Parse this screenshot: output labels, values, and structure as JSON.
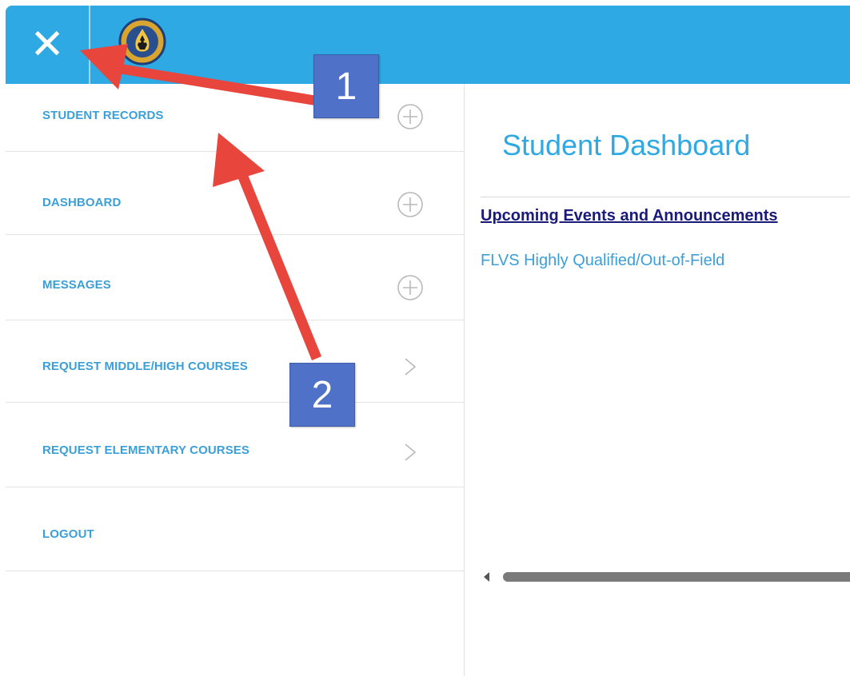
{
  "colors": {
    "topbar": "#2ea9e3",
    "menu_text": "#3b9fd8",
    "title": "#2ea9e3",
    "events_link": "#1a1a7a",
    "annotation_arrow": "#e8453c",
    "annotation_badge": "#4f72c8"
  },
  "header": {
    "close_icon": "close-icon",
    "close_glyph": "✕",
    "logo_icon": "school-seal-logo"
  },
  "sidebar": {
    "items": [
      {
        "label": "STUDENT RECORDS",
        "icon": "plus-circle-icon"
      },
      {
        "label": "DASHBOARD",
        "icon": "plus-circle-icon"
      },
      {
        "label": "MESSAGES",
        "icon": "plus-circle-icon"
      },
      {
        "label": "REQUEST MIDDLE/HIGH COURSES",
        "icon": "chevron-right-icon"
      },
      {
        "label": "REQUEST ELEMENTARY COURSES",
        "icon": "chevron-right-icon"
      },
      {
        "label": "LOGOUT",
        "icon": ""
      }
    ]
  },
  "main": {
    "title": "Student Dashboard",
    "events_link": "Upcoming Events and Announcements",
    "flvs_link": "FLVS Highly Qualified/Out-of-Field"
  },
  "annotations": {
    "badge_1": "1",
    "badge_2": "2"
  }
}
